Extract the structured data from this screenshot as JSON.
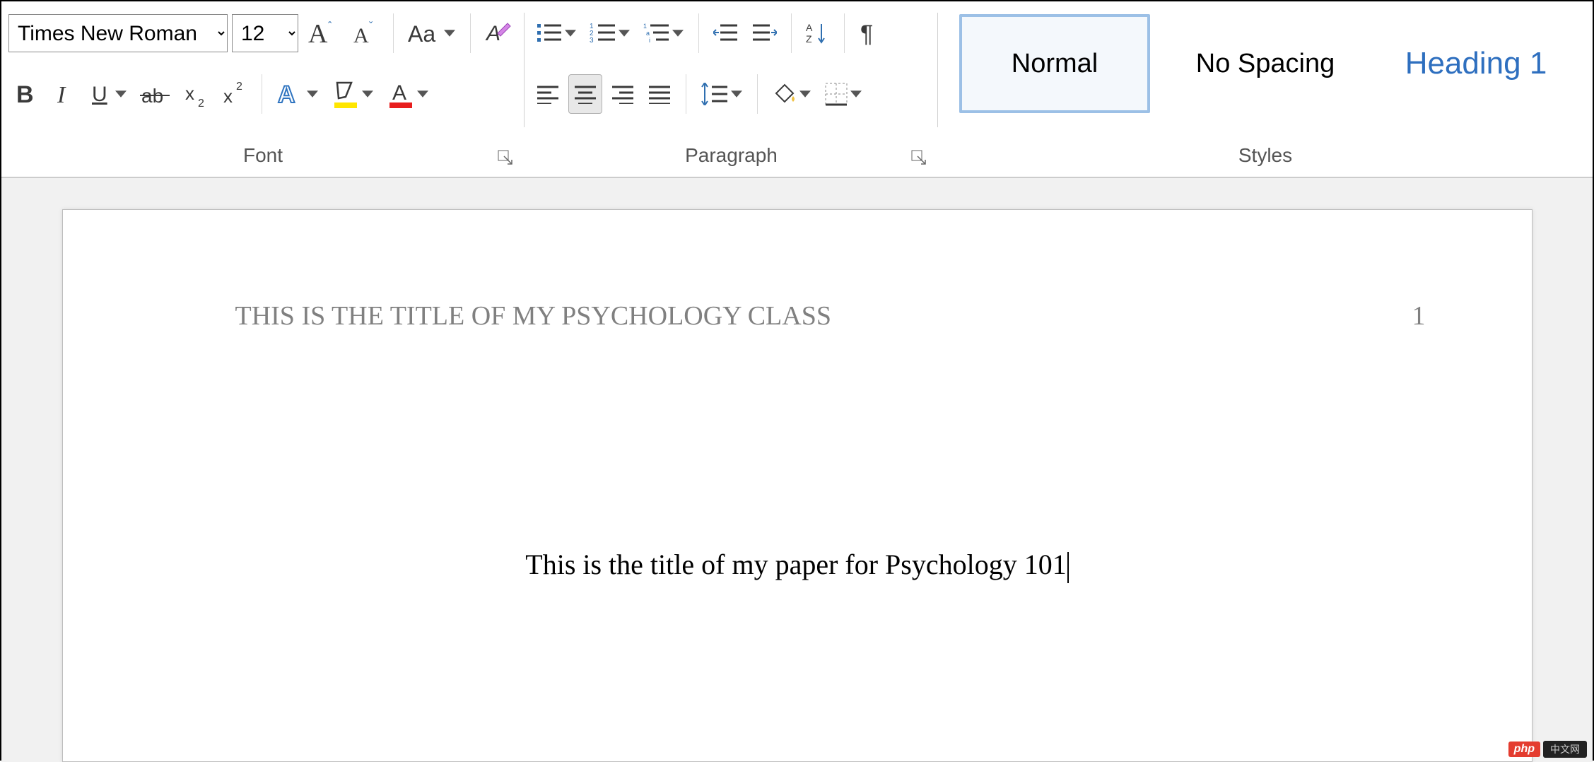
{
  "ribbon": {
    "font": {
      "label": "Font",
      "name_value": "Times New Roman",
      "size_value": "12"
    },
    "paragraph": {
      "label": "Paragraph"
    },
    "styles": {
      "label": "Styles",
      "items": [
        {
          "label": "Normal",
          "selected": true,
          "heading": false
        },
        {
          "label": "No Spacing",
          "selected": false,
          "heading": false
        },
        {
          "label": "Heading 1",
          "selected": false,
          "heading": true
        }
      ]
    }
  },
  "document": {
    "header_text": "THIS IS THE TITLE OF MY PSYCHOLOGY CLASS",
    "page_number": "1",
    "body_text": "This is the title of my paper for Psychology 101"
  },
  "watermark": {
    "left": "php",
    "right": "中文网"
  }
}
